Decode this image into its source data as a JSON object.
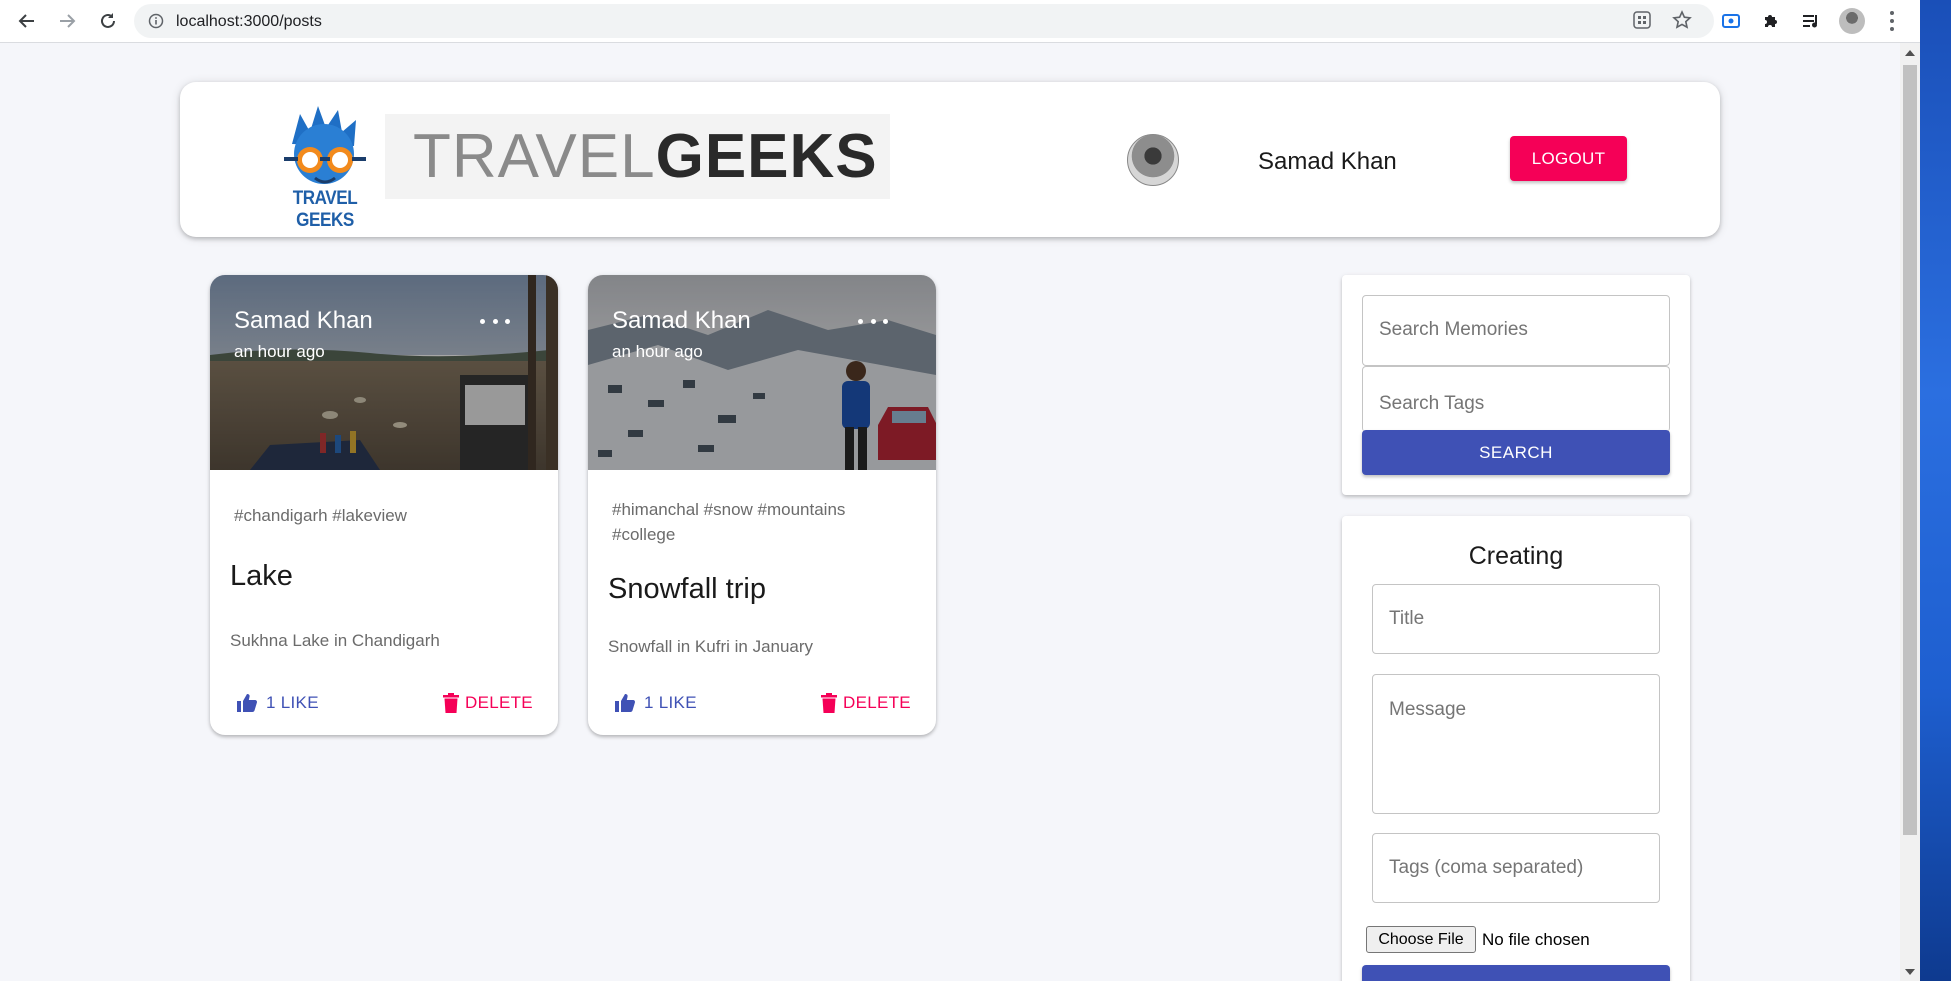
{
  "browser": {
    "url": "localhost:3000/posts"
  },
  "header": {
    "logo_caption": "TRAVEL GEEKS",
    "wordmark_light": "TRAVEL",
    "wordmark_bold": "GEEKS",
    "user_name": "Samad Khan",
    "logout_label": "LOGOUT"
  },
  "posts": [
    {
      "author": "Samad Khan",
      "time": "an hour ago",
      "tags": "#chandigarh #lakeview",
      "title": "Lake",
      "message": "Sukhna Lake in Chandigarh",
      "like_label": "1 LIKE",
      "delete_label": "DELETE"
    },
    {
      "author": "Samad Khan",
      "time": "an hour ago",
      "tags": "#himanchal #snow #mountains #college",
      "title": "Snowfall trip",
      "message": "Snowfall in Kufri in January",
      "like_label": "1 LIKE",
      "delete_label": "DELETE"
    }
  ],
  "search": {
    "memories_placeholder": "Search Memories",
    "tags_placeholder": "Search Tags",
    "button_label": "SEARCH"
  },
  "form": {
    "heading": "Creating",
    "title_placeholder": "Title",
    "message_placeholder": "Message",
    "tags_placeholder": "Tags (coma separated)",
    "file_button": "Choose File",
    "file_status": "No file chosen"
  },
  "colors": {
    "primary": "#3f51b5",
    "secondary": "#f50057",
    "page_bg": "#f5f6fa"
  }
}
